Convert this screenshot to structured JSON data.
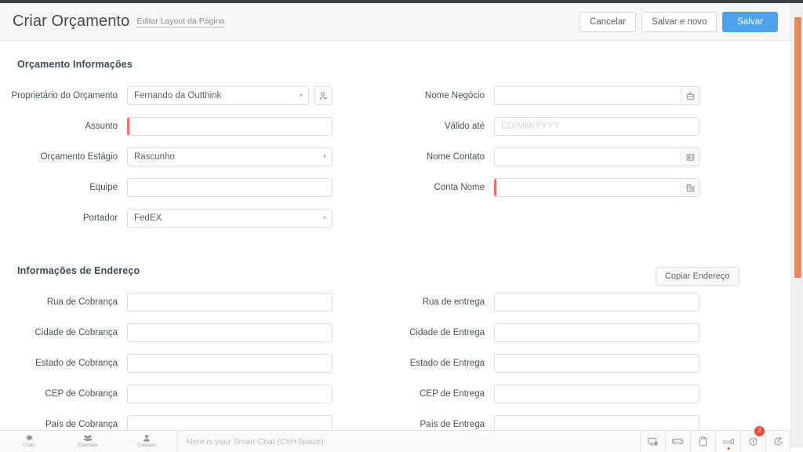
{
  "header": {
    "title": "Criar Orçamento",
    "edit_layout_link": "Editar Layout da Página",
    "cancel_label": "Cancelar",
    "save_new_label": "Salvar e novo",
    "save_label": "Salvar",
    "primary_color": "#4da2e8"
  },
  "scrollbar": {
    "thumb_color": "#ec8464"
  },
  "sections": [
    {
      "title": "Orçamento Informações",
      "left_fields": [
        {
          "label": "Proprietário do Orçamento",
          "value": "Fernando da Outthink",
          "placeholder": "",
          "type": "select-lookup",
          "required": false,
          "icon": "person-icon"
        },
        {
          "label": "Assunto",
          "value": "",
          "placeholder": "",
          "type": "text",
          "required": true,
          "icon": ""
        },
        {
          "label": "Orçamento Estágio",
          "value": "Rascunho",
          "placeholder": "",
          "type": "select",
          "required": false,
          "icon": ""
        },
        {
          "label": "Equipe",
          "value": "",
          "placeholder": "",
          "type": "text",
          "required": false,
          "icon": ""
        },
        {
          "label": "Portador",
          "value": "FedEX",
          "placeholder": "",
          "type": "select",
          "required": false,
          "icon": ""
        }
      ],
      "right_fields": [
        {
          "label": "Nome Negócio",
          "value": "",
          "placeholder": "",
          "type": "text-icon",
          "required": false,
          "icon": "briefcase-icon"
        },
        {
          "label": "Válido até",
          "value": "",
          "placeholder": "DD/MM/YYYY",
          "type": "text",
          "required": false,
          "icon": ""
        },
        {
          "label": "Nome Contato",
          "value": "",
          "placeholder": "",
          "type": "text-icon",
          "required": false,
          "icon": "contact-card-icon"
        },
        {
          "label": "Conta Nome",
          "value": "",
          "placeholder": "",
          "type": "text-icon",
          "required": true,
          "icon": "building-icon"
        }
      ]
    },
    {
      "title": "Informações de Endereço",
      "copy_button": "Copiar Endereço",
      "left_fields": [
        {
          "label": "Rua de Cobrança",
          "value": "",
          "placeholder": "",
          "type": "text",
          "required": false,
          "icon": ""
        },
        {
          "label": "Cidade de Cobrança",
          "value": "",
          "placeholder": "",
          "type": "text",
          "required": false,
          "icon": ""
        },
        {
          "label": "Estado de Cobrança",
          "value": "",
          "placeholder": "",
          "type": "text",
          "required": false,
          "icon": ""
        },
        {
          "label": "CEP de Cobrança",
          "value": "",
          "placeholder": "",
          "type": "text",
          "required": false,
          "icon": ""
        },
        {
          "label": "País de Cobrança",
          "value": "",
          "placeholder": "",
          "type": "text",
          "required": false,
          "icon": ""
        }
      ],
      "right_fields": [
        {
          "label": "Rua de entrega",
          "value": "",
          "placeholder": "",
          "type": "text",
          "required": false,
          "icon": ""
        },
        {
          "label": "Cidade de Entrega",
          "value": "",
          "placeholder": "",
          "type": "text",
          "required": false,
          "icon": ""
        },
        {
          "label": "Estado de Entrega",
          "value": "",
          "placeholder": "",
          "type": "text",
          "required": false,
          "icon": ""
        },
        {
          "label": "CEP de Entrega",
          "value": "",
          "placeholder": "",
          "type": "text",
          "required": false,
          "icon": ""
        },
        {
          "label": "País de Entrega",
          "value": "",
          "placeholder": "",
          "type": "text",
          "required": false,
          "icon": ""
        }
      ]
    }
  ],
  "bottombar": {
    "nav": [
      {
        "label": "Chats",
        "icon": "chat-bubble-icon"
      },
      {
        "label": "Channels",
        "icon": "channels-icon"
      },
      {
        "label": "Contacts",
        "icon": "contact-person-icon"
      }
    ],
    "chat_placeholder": "Here is your Smart Chat (Ctrl+Space)",
    "tools": [
      {
        "icon": "screen-share-icon",
        "badge": "",
        "dot": false
      },
      {
        "icon": "gamepad-icon",
        "badge": "",
        "dot": false
      },
      {
        "icon": "clipboard-icon",
        "badge": "",
        "dot": false
      },
      {
        "icon": "zoom-meeting-icon",
        "badge": "",
        "dot": true
      },
      {
        "icon": "alarm-clock-icon",
        "badge": "2",
        "dot": false
      },
      {
        "icon": "history-clock-icon",
        "badge": "",
        "dot": false
      }
    ]
  }
}
